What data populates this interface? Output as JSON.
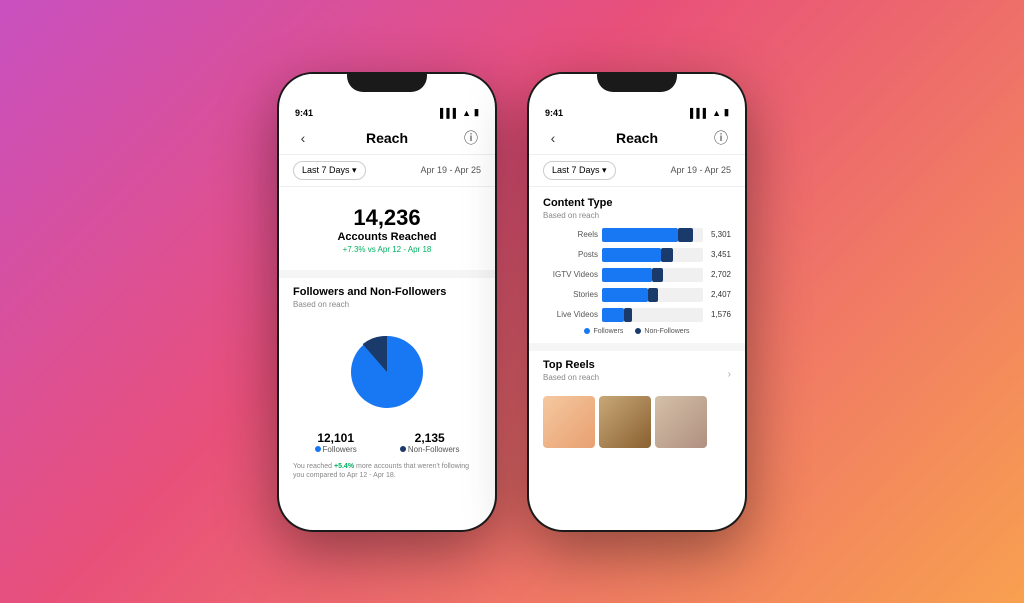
{
  "background": {
    "gradient": "pink-orange"
  },
  "phone1": {
    "status_bar": {
      "time": "9:41",
      "signal": "●●●●",
      "wifi": "wifi",
      "battery": "battery"
    },
    "header": {
      "back_label": "‹",
      "title": "Reach",
      "info_icon": "ⓘ"
    },
    "filter": {
      "dropdown_label": "Last 7 Days ▾",
      "date_range": "Apr 19 - Apr 25"
    },
    "accounts_reached": {
      "number": "14,236",
      "label": "Accounts Reached",
      "change": "+7.3% vs Apr 12 - Apr 18"
    },
    "followers_section": {
      "title": "Followers and Non-Followers",
      "subtitle": "Based on reach",
      "followers_count": "12,101",
      "followers_label": "Followers",
      "nonfollowers_count": "2,135",
      "nonfollowers_label": "Non-Followers",
      "note_pre": "You reached ",
      "note_highlight": "+5.4%",
      "note_post": " more accounts that weren't following you compared to Apr 12 - Apr 18."
    }
  },
  "phone2": {
    "status_bar": {
      "time": "9:41"
    },
    "header": {
      "back_label": "‹",
      "title": "Reach",
      "info_icon": "ⓘ"
    },
    "filter": {
      "dropdown_label": "Last 7 Days ▾",
      "date_range": "Apr 19 - Apr 25"
    },
    "content_type": {
      "title": "Content Type",
      "subtitle": "Based on reach",
      "bars": [
        {
          "label": "Reels",
          "followers_pct": 75,
          "nonfollowers_pct": 15,
          "value": "5,301"
        },
        {
          "label": "Posts",
          "followers_pct": 58,
          "nonfollowers_pct": 12,
          "value": "3,451"
        },
        {
          "label": "IGTV Videos",
          "followers_pct": 50,
          "nonfollowers_pct": 10,
          "value": "2,702"
        },
        {
          "label": "Stories",
          "followers_pct": 46,
          "nonfollowers_pct": 9,
          "value": "2,407"
        },
        {
          "label": "Live Videos",
          "followers_pct": 22,
          "nonfollowers_pct": 8,
          "value": "1,576"
        }
      ],
      "legend": {
        "followers": "Followers",
        "nonfollowers": "Non-Followers"
      }
    },
    "top_reels": {
      "title": "Top Reels",
      "subtitle": "Based on reach"
    }
  }
}
